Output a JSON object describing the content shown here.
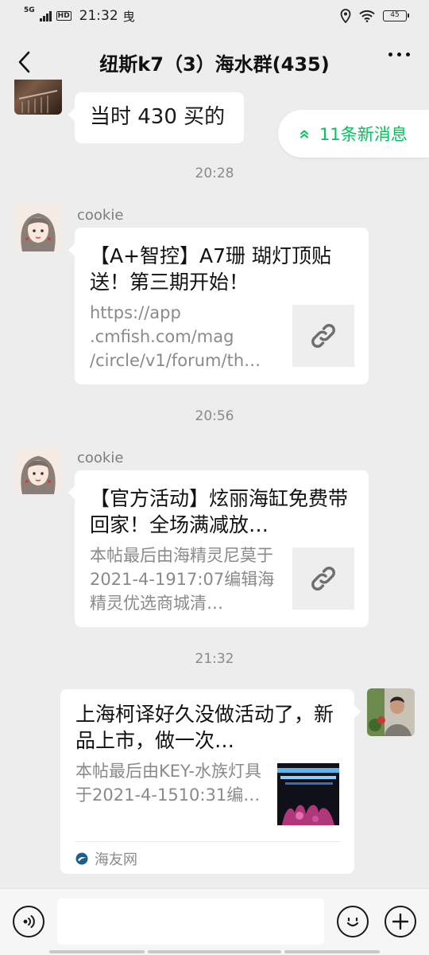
{
  "status": {
    "network": "5G",
    "hd": "HD",
    "time": "21:32",
    "notification_glyph": "曳",
    "battery": "45"
  },
  "nav": {
    "title": "纽斯k7（3）海水群(435)"
  },
  "new_messages": {
    "label": "11条新消息"
  },
  "messages": {
    "m0": {
      "text": "当时 430 买的"
    },
    "t1": "20:28",
    "m1": {
      "sender": "cookie",
      "title": "【A+智控】A7珊 瑚灯顶贴送！第三期开始！",
      "desc": "https://app .cmfish.com/mag /circle/v1/forum/th…"
    },
    "t2": "20:56",
    "m2": {
      "sender": "cookie",
      "title": "【官方活动】炫丽海缸免费带回家！全场满减放…",
      "desc": "本帖最后由海精灵尼莫于2021-4-1917:07编辑海精灵优选商城清…"
    },
    "t3": "21:32",
    "m3": {
      "title": "上海柯译好久没做活动了，新品上市，做一次…",
      "desc": "本帖最后由KEY-水族灯具于2021-4-1510:31编…",
      "source": "海友网"
    }
  },
  "input": {
    "placeholder": ""
  },
  "colors": {
    "accent_green": "#07c160",
    "chat_bg": "#ededed",
    "bubble_bg": "#ffffff"
  }
}
